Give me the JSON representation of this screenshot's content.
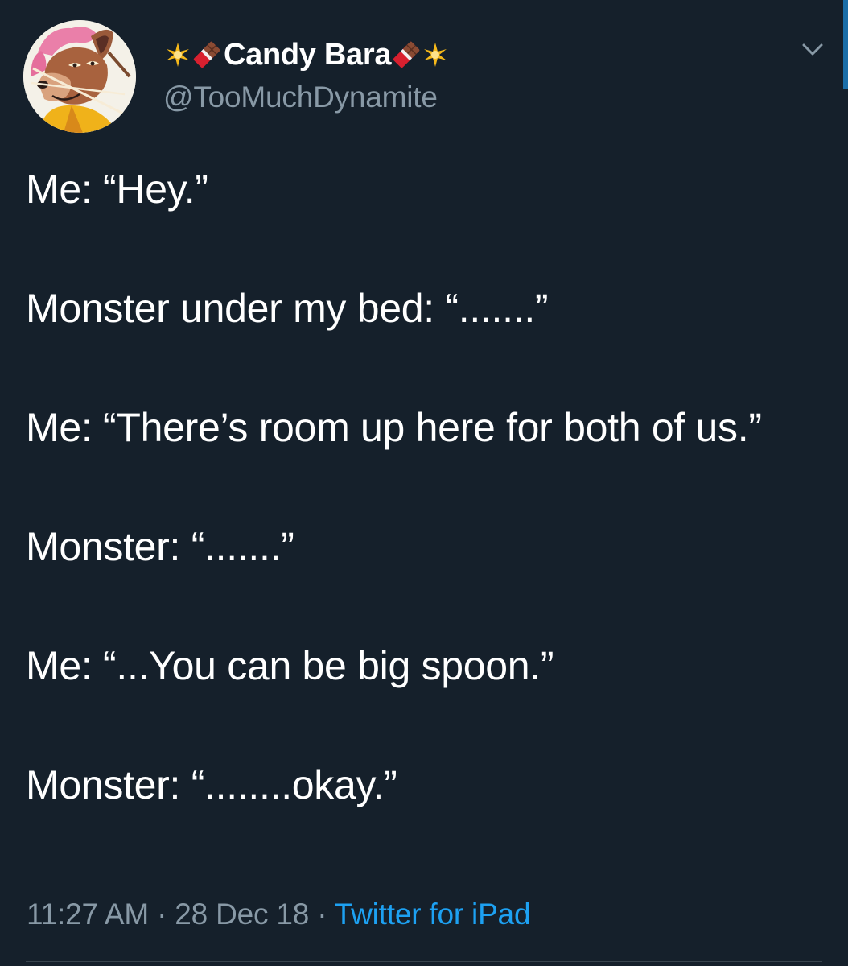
{
  "author": {
    "display_name": "Candy Bara",
    "handle": "@TooMuchDynamite",
    "name_prefix_icons": [
      "sparkle-icon",
      "chocolate-bar-icon"
    ],
    "name_suffix_icons": [
      "chocolate-bar-icon",
      "sparkle-icon"
    ]
  },
  "tweet": {
    "lines": [
      "Me: “Hey.”",
      "Monster under my bed: “.......”",
      "Me: “There’s room up here for both of us.”",
      "Monster: “.......”",
      "Me: “...You can be big spoon.”",
      "Monster: “........okay.”"
    ],
    "time": "11:27 AM",
    "date": "28 Dec 18",
    "source": "Twitter for iPad",
    "separator": " · "
  },
  "colors": {
    "background": "#15202b",
    "text": "#ffffff",
    "secondary_text": "#8899a6",
    "link": "#1da1f2",
    "divider": "#38444d"
  }
}
